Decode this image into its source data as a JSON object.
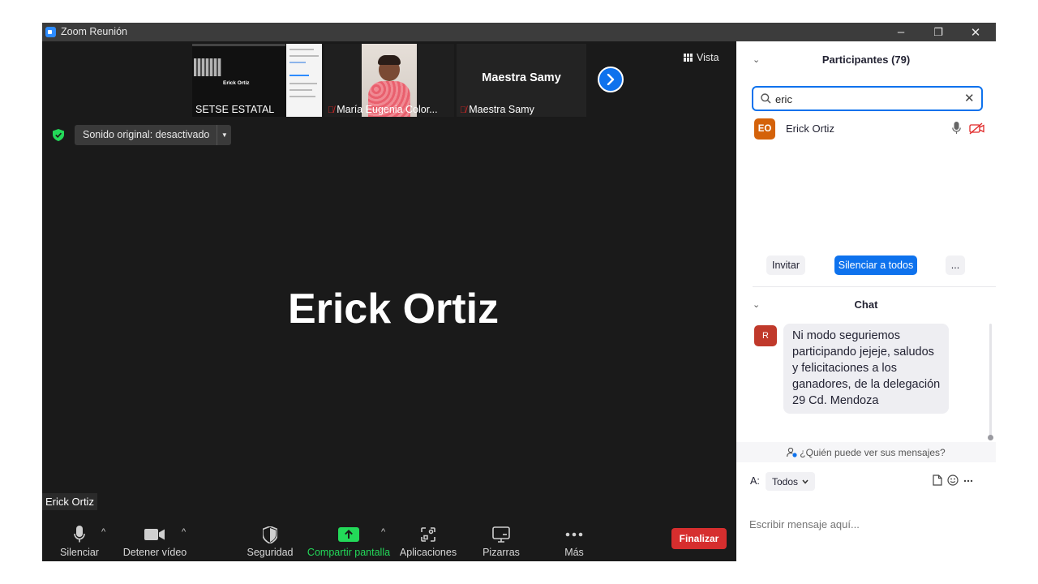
{
  "window": {
    "title": "Zoom Reunión",
    "minimize_glyph": "–",
    "maximize_glyph": "❐",
    "close_glyph": "✕"
  },
  "thumbnails": [
    {
      "name": "SETSE ESTATAL",
      "inner_text": "Erick Ortiz",
      "mic_muted": false
    },
    {
      "name": "María Eugenia Color...",
      "mic_muted": true
    },
    {
      "name": "Maestra Samy",
      "center_text": "Maestra Samy",
      "mic_muted": true
    }
  ],
  "view_button": {
    "label": "Vista"
  },
  "original_sound": {
    "label": "Sonido original: desactivado"
  },
  "active_speaker": {
    "name": "Erick Ortiz"
  },
  "name_label": "Erick Ortiz",
  "toolbar": {
    "mute": "Silenciar",
    "video": "Detener vídeo",
    "security": "Seguridad",
    "share": "Compartir pantalla",
    "apps": "Aplicaciones",
    "whiteboards": "Pizarras",
    "more": "Más",
    "end": "Finalizar"
  },
  "participants_panel": {
    "title": "Participantes (79)",
    "search_value": "eric",
    "results": [
      {
        "initials": "EO",
        "name": "Erick Ortiz"
      }
    ],
    "invite": "Invitar",
    "mute_all": "Silenciar a todos",
    "more": "..."
  },
  "chat_panel": {
    "title": "Chat",
    "messages": [
      {
        "initial": "R",
        "text": "Ni modo seguriemos participando jejeje, saludos y felicitaciones a los ganadores, de la delegación 29 Cd. Mendoza"
      }
    ],
    "who_can_see": "¿Quién puede ver sus mensajes?",
    "to_label": "A:",
    "to_value": "Todos",
    "input_placeholder": "Escribir mensaje aquí..."
  },
  "colors": {
    "accent": "#0e72ed",
    "end_red": "#d62e2e",
    "share_green": "#23d959",
    "avatar_orange": "#d4620a"
  }
}
